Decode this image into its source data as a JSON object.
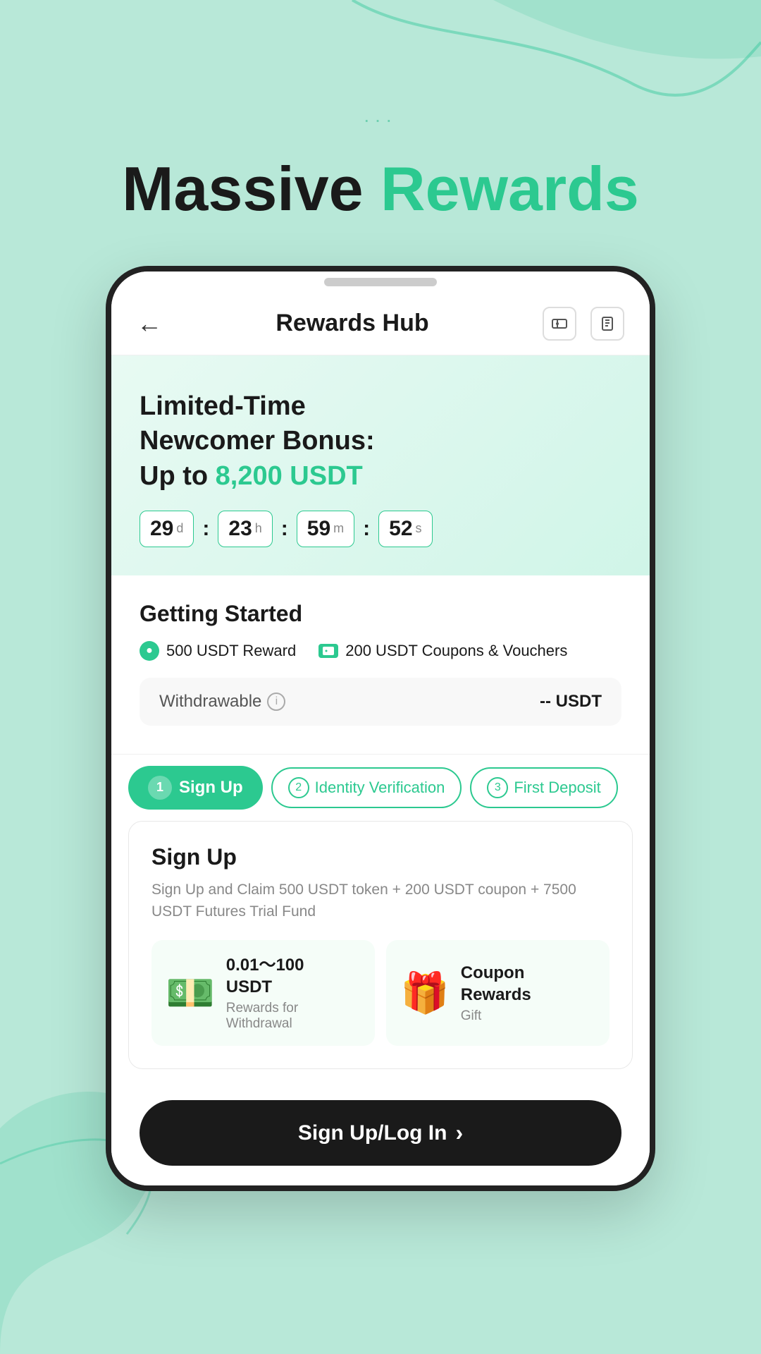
{
  "page": {
    "background_color": "#b8e8d8",
    "dots": "...",
    "headline": {
      "prefix": "Massive ",
      "highlight": "Rewards"
    }
  },
  "header": {
    "title": "Rewards Hub",
    "back_label": "←",
    "icon1": "ticket",
    "icon2": "clipboard"
  },
  "banner": {
    "line1": "Limited-Time",
    "line2": "Newcomer Bonus:",
    "line3_prefix": "Up to ",
    "amount": "8,200 USDT",
    "timer": {
      "days_num": "29",
      "days_unit": "d",
      "hours_num": "23",
      "hours_unit": "h",
      "minutes_num": "59",
      "minutes_unit": "m",
      "seconds_num": "52",
      "seconds_unit": "s"
    }
  },
  "getting_started": {
    "title": "Getting Started",
    "reward1": "500 USDT Reward",
    "reward2": "200 USDT Coupons & Vouchers",
    "withdrawable_label": "Withdrawable",
    "withdrawable_value": "-- USDT"
  },
  "tabs": [
    {
      "num": "1",
      "label": "Sign Up",
      "active": true
    },
    {
      "num": "2",
      "label": "Identity Verification",
      "active": false
    },
    {
      "num": "3",
      "label": "First Deposit",
      "active": false
    }
  ],
  "signup_card": {
    "title": "Sign Up",
    "description": "Sign Up and Claim 500 USDT token + 200 USDT coupon + 7500 USDT Futures Trial Fund",
    "reward1": {
      "emoji": "💵",
      "title": "0.01～100\nUSDT",
      "subtitle": "Rewards for\nWithdrawal"
    },
    "reward2": {
      "emoji": "🎁",
      "title": "Coupon\nRewards",
      "subtitle": "Gift"
    }
  },
  "bottom_button": {
    "label": "Sign Up/Log In",
    "arrow": "›"
  }
}
